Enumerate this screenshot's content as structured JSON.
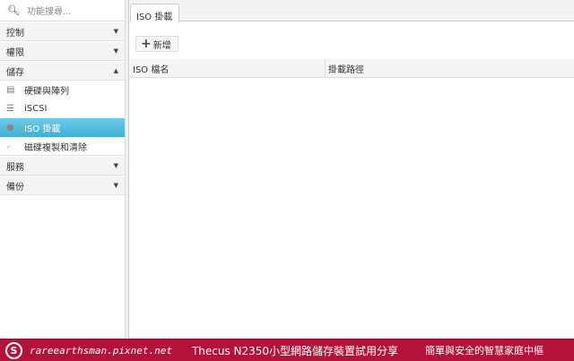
{
  "sidebar": {
    "search_placeholder": "功能搜尋...",
    "groups": {
      "control": "控制",
      "permission": "權限",
      "storage": "儲存",
      "service": "服務",
      "backup": "備份"
    },
    "storage_items": [
      "硬碟與陣列",
      "iSCSI",
      "ISO 掛載",
      "磁碟複製和清除"
    ]
  },
  "main": {
    "tab": "ISO 掛載",
    "add_label": "新增",
    "columns": [
      "ISO 檔名",
      "掛載路徑"
    ]
  },
  "footer": {
    "site": "rareearthsman.pixnet.net",
    "title": "Thecus N2350小型網路儲存裝置試用分享",
    "slogan": "簡單與安全的智慧家庭中樞",
    "color": "#b3123b"
  }
}
